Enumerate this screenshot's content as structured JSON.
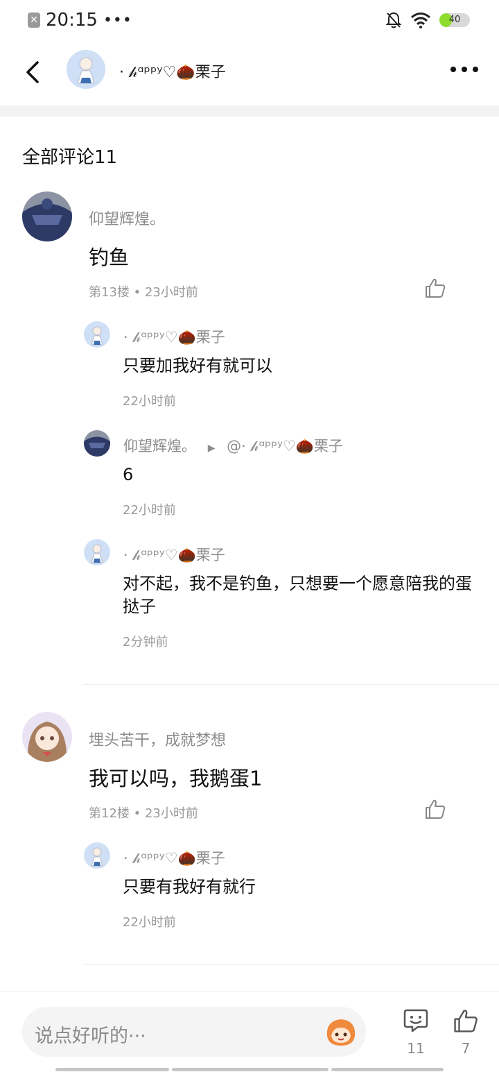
{
  "status": {
    "time": "20:15",
    "dots": "•••",
    "battery": "40",
    "battery_level_percent": 40
  },
  "header": {
    "username": "· 𝒽ᵅᵖᵖʸ♡🌰栗子"
  },
  "section_title": "全部评论11",
  "comments": [
    {
      "name": "仰望辉煌。",
      "text": "钓鱼",
      "floor": "第13楼",
      "time": "23小时前",
      "replies": [
        {
          "name": "· 𝒽ᵅᵖᵖʸ♡🌰栗子",
          "target": "",
          "text": "只要加我好有就可以",
          "time": "22小时前"
        },
        {
          "name": "仰望辉煌。",
          "target": "@· 𝒽ᵅᵖᵖʸ♡🌰栗子",
          "text": "6",
          "time": "22小时前"
        },
        {
          "name": "· 𝒽ᵅᵖᵖʸ♡🌰栗子",
          "target": "",
          "text": "对不起，我不是钓鱼，只想要一个愿意陪我的蛋挞子",
          "time": "2分钟前"
        }
      ]
    },
    {
      "name": "埋头苦干，成就梦想",
      "text": "我可以吗，我鹅蛋1",
      "floor": "第12楼",
      "time": "23小时前",
      "replies": [
        {
          "name": "· 𝒽ᵅᵖᵖʸ♡🌰栗子",
          "target": "",
          "text": "只要有我好有就行",
          "time": "22小时前"
        }
      ]
    }
  ],
  "bottom": {
    "placeholder": "说点好听的···",
    "comment_count": "11",
    "like_count": "7"
  },
  "colors": {
    "meta_gray": "#9a9a9a",
    "text": "#111111",
    "battery": "#8fdc2c"
  }
}
